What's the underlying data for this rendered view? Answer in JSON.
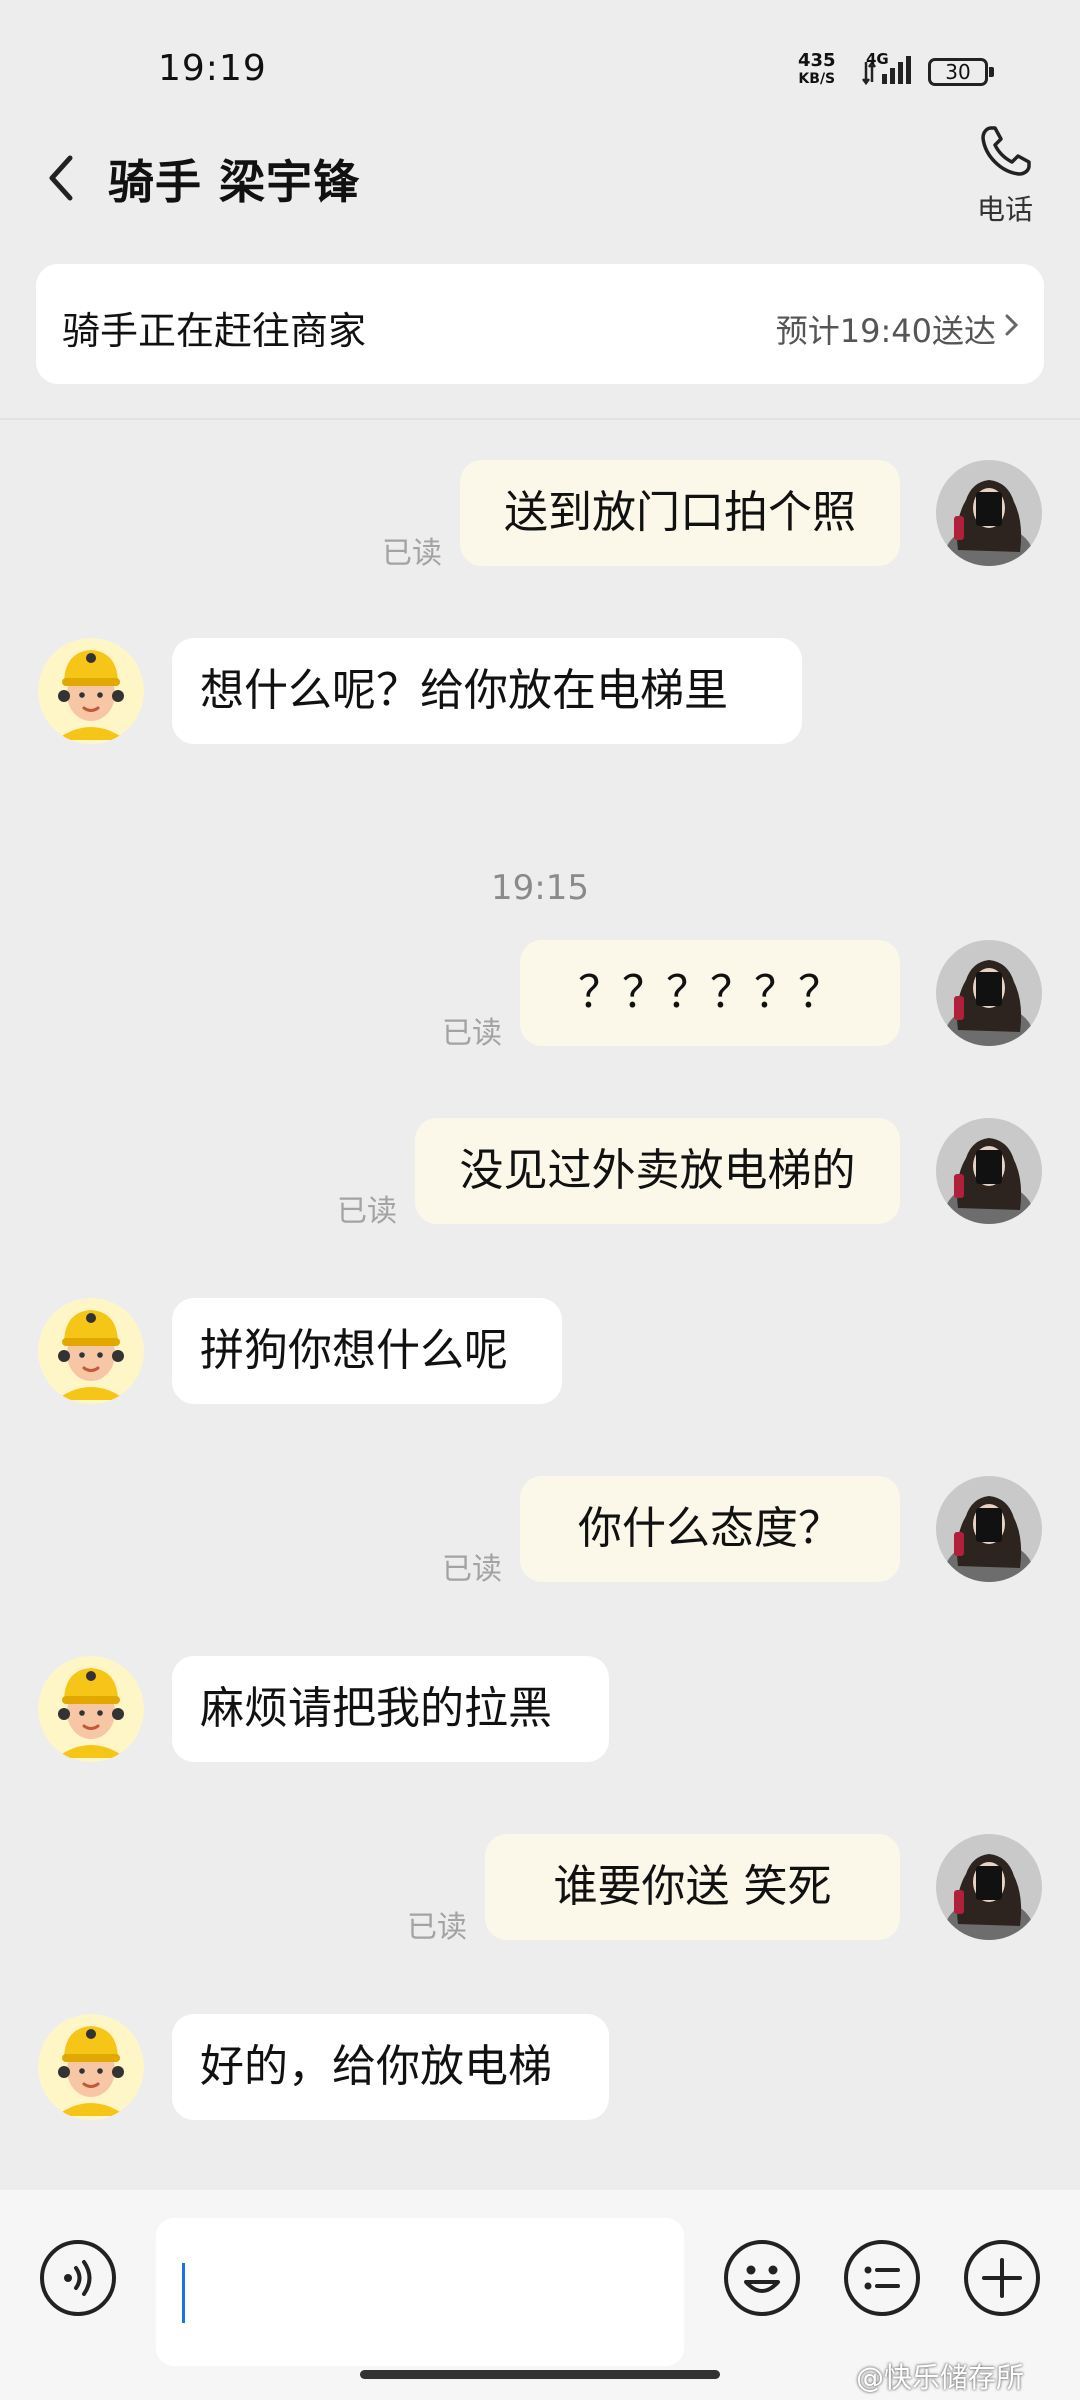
{
  "status_bar": {
    "time": "19:19",
    "net_speed_value": "435",
    "net_speed_unit": "KB/S",
    "network": "4G",
    "battery": "30"
  },
  "header": {
    "title": "骑手 梁宇锋",
    "call_label": "电话"
  },
  "order_card": {
    "status": "骑手正在赶往商家",
    "eta": "预计19:40送达"
  },
  "messages": [
    {
      "side": "me",
      "text": "送到放门口拍个照",
      "read": "已读"
    },
    {
      "side": "rider",
      "text": "想什么呢？给你放在电梯里"
    },
    {
      "timestamp": "19:15"
    },
    {
      "side": "me",
      "text": "？？？？？？",
      "read": "已读"
    },
    {
      "side": "me",
      "text": "没见过外卖放电梯的",
      "read": "已读"
    },
    {
      "side": "rider",
      "text": "拼狗你想什么呢"
    },
    {
      "side": "me",
      "text": "你什么态度？",
      "read": "已读"
    },
    {
      "side": "rider",
      "text": "麻烦请把我的拉黑"
    },
    {
      "side": "me",
      "text": "谁要你送   笑死",
      "read": "已读"
    },
    {
      "side": "rider",
      "text": "好的，给你放电梯"
    }
  ],
  "input_bar": {
    "value": "",
    "icons": [
      "voice-icon",
      "emoji-icon",
      "quick-reply-icon",
      "plus-icon"
    ]
  },
  "watermark": "@快乐储存所",
  "colors": {
    "background": "#ededed",
    "my_bubble": "#fbf8ea",
    "rider_bubble": "#ffffff",
    "rider_helmet": "#f5c518",
    "caret": "#1a73e8"
  }
}
